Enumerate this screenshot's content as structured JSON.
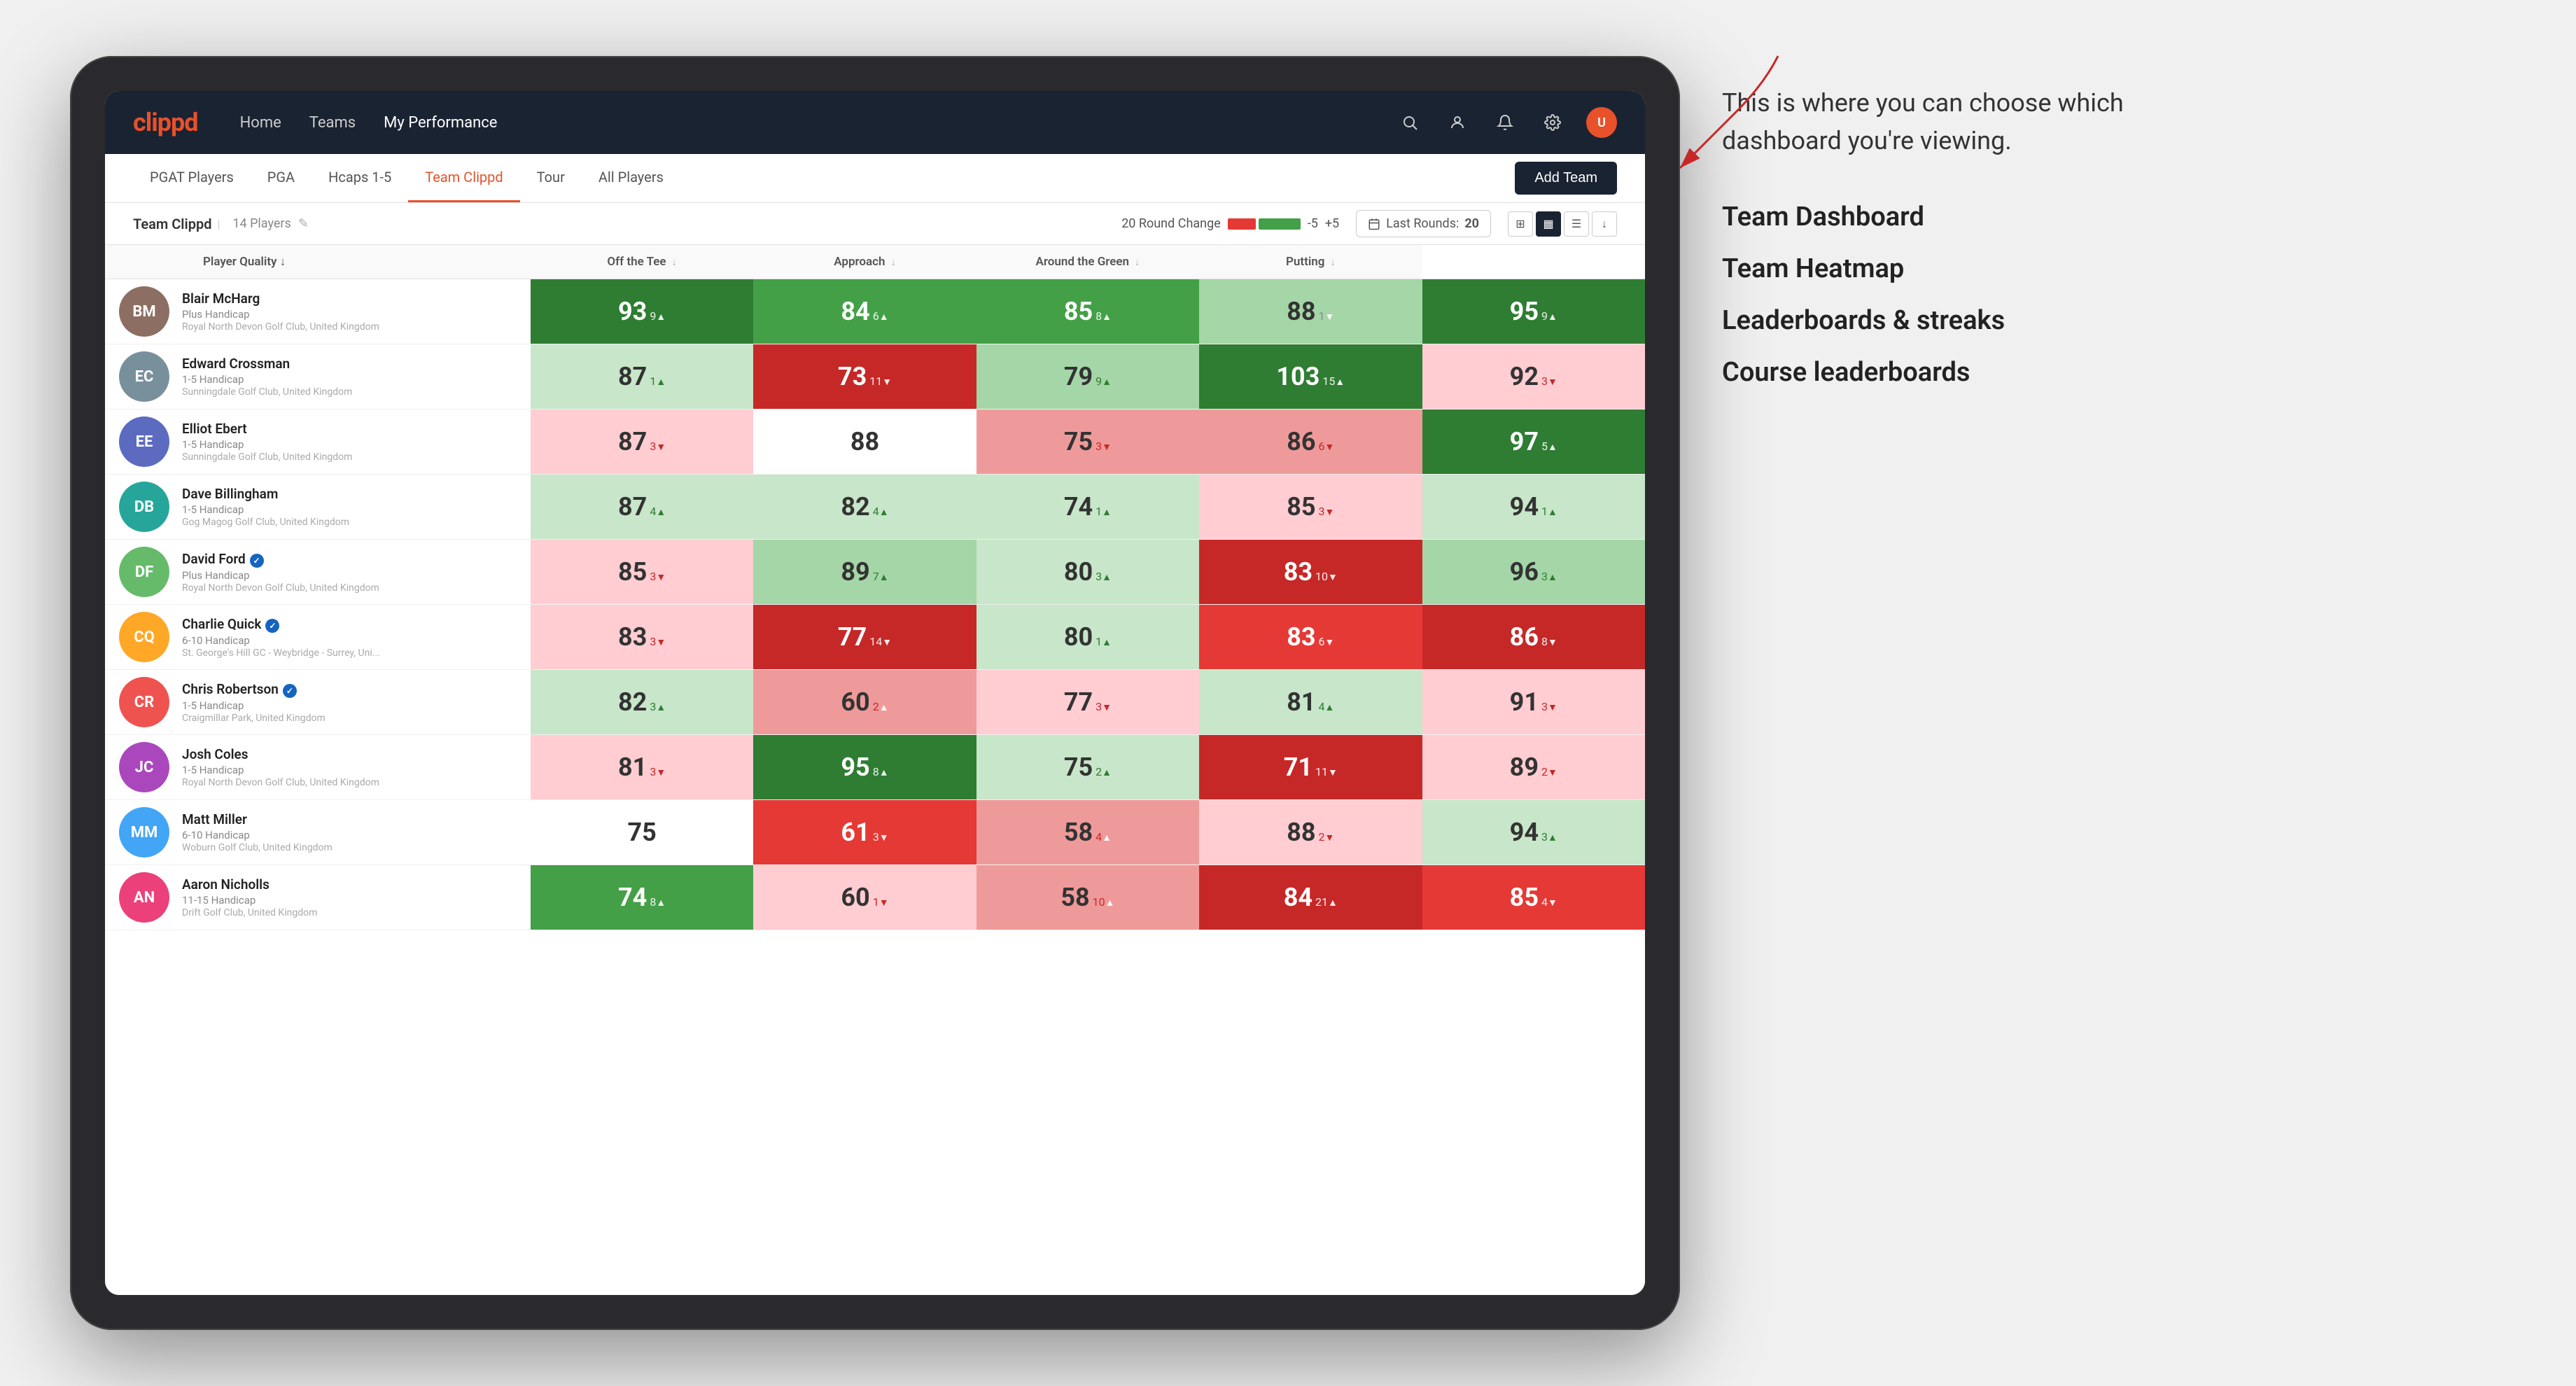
{
  "annotation": {
    "description": "This is where you can choose which dashboard you're viewing.",
    "dashboard_options": [
      "Team Dashboard",
      "Team Heatmap",
      "Leaderboards & streaks",
      "Course leaderboards"
    ]
  },
  "nav": {
    "logo": "clippd",
    "links": [
      "Home",
      "Teams",
      "My Performance"
    ],
    "active_link": "My Performance"
  },
  "sub_nav": {
    "links": [
      "PGAT Players",
      "PGA",
      "Hcaps 1-5",
      "Team Clippd",
      "Tour",
      "All Players"
    ],
    "active": "Team Clippd",
    "add_team_label": "Add Team"
  },
  "team_header": {
    "name": "Team Clippd",
    "separator": "|",
    "count": "14 Players",
    "round_change_label": "20 Round Change",
    "change_min": "-5",
    "change_max": "+5",
    "last_rounds_label": "Last Rounds:",
    "last_rounds_value": "20"
  },
  "table": {
    "columns": [
      {
        "label": "Player Quality",
        "arrow": "↓"
      },
      {
        "label": "Off the Tee",
        "arrow": "↓"
      },
      {
        "label": "Approach",
        "arrow": "↓"
      },
      {
        "label": "Around the Green",
        "arrow": "↓"
      },
      {
        "label": "Putting",
        "arrow": "↓"
      }
    ],
    "rows": [
      {
        "name": "Blair McHarg",
        "handicap": "Plus Handicap",
        "club": "Royal North Devon Golf Club, United Kingdom",
        "verified": false,
        "stats": [
          {
            "value": "93",
            "change": "9",
            "dir": "up",
            "bg": "green-dark"
          },
          {
            "value": "84",
            "change": "6",
            "dir": "up",
            "bg": "green-med"
          },
          {
            "value": "85",
            "change": "8",
            "dir": "up",
            "bg": "green-med"
          },
          {
            "value": "88",
            "change": "1",
            "dir": "down",
            "bg": "green-light"
          },
          {
            "value": "95",
            "change": "9",
            "dir": "up",
            "bg": "green-dark"
          }
        ]
      },
      {
        "name": "Edward Crossman",
        "handicap": "1-5 Handicap",
        "club": "Sunningdale Golf Club, United Kingdom",
        "verified": false,
        "stats": [
          {
            "value": "87",
            "change": "1",
            "dir": "up",
            "bg": "green-pale"
          },
          {
            "value": "73",
            "change": "11",
            "dir": "down",
            "bg": "red-dark"
          },
          {
            "value": "79",
            "change": "9",
            "dir": "up",
            "bg": "green-light"
          },
          {
            "value": "103",
            "change": "15",
            "dir": "up",
            "bg": "green-dark"
          },
          {
            "value": "92",
            "change": "3",
            "dir": "down",
            "bg": "red-pale"
          }
        ]
      },
      {
        "name": "Elliot Ebert",
        "handicap": "1-5 Handicap",
        "club": "Sunningdale Golf Club, United Kingdom",
        "verified": false,
        "stats": [
          {
            "value": "87",
            "change": "3",
            "dir": "down",
            "bg": "red-pale"
          },
          {
            "value": "88",
            "change": "",
            "dir": "neutral",
            "bg": "white"
          },
          {
            "value": "75",
            "change": "3",
            "dir": "down",
            "bg": "red-light"
          },
          {
            "value": "86",
            "change": "6",
            "dir": "down",
            "bg": "red-light"
          },
          {
            "value": "97",
            "change": "5",
            "dir": "up",
            "bg": "green-dark"
          }
        ]
      },
      {
        "name": "Dave Billingham",
        "handicap": "1-5 Handicap",
        "club": "Gog Magog Golf Club, United Kingdom",
        "verified": false,
        "stats": [
          {
            "value": "87",
            "change": "4",
            "dir": "up",
            "bg": "green-pale"
          },
          {
            "value": "82",
            "change": "4",
            "dir": "up",
            "bg": "green-pale"
          },
          {
            "value": "74",
            "change": "1",
            "dir": "up",
            "bg": "green-pale"
          },
          {
            "value": "85",
            "change": "3",
            "dir": "down",
            "bg": "red-pale"
          },
          {
            "value": "94",
            "change": "1",
            "dir": "up",
            "bg": "green-pale"
          }
        ]
      },
      {
        "name": "David Ford",
        "handicap": "Plus Handicap",
        "club": "Royal North Devon Golf Club, United Kingdom",
        "verified": true,
        "stats": [
          {
            "value": "85",
            "change": "3",
            "dir": "down",
            "bg": "red-pale"
          },
          {
            "value": "89",
            "change": "7",
            "dir": "up",
            "bg": "green-light"
          },
          {
            "value": "80",
            "change": "3",
            "dir": "up",
            "bg": "green-pale"
          },
          {
            "value": "83",
            "change": "10",
            "dir": "down",
            "bg": "red-dark"
          },
          {
            "value": "96",
            "change": "3",
            "dir": "up",
            "bg": "green-light"
          }
        ]
      },
      {
        "name": "Charlie Quick",
        "handicap": "6-10 Handicap",
        "club": "St. George's Hill GC - Weybridge - Surrey, Uni...",
        "verified": true,
        "stats": [
          {
            "value": "83",
            "change": "3",
            "dir": "down",
            "bg": "red-pale"
          },
          {
            "value": "77",
            "change": "14",
            "dir": "down",
            "bg": "red-dark"
          },
          {
            "value": "80",
            "change": "1",
            "dir": "up",
            "bg": "green-pale"
          },
          {
            "value": "83",
            "change": "6",
            "dir": "down",
            "bg": "red-med"
          },
          {
            "value": "86",
            "change": "8",
            "dir": "down",
            "bg": "red-dark"
          }
        ]
      },
      {
        "name": "Chris Robertson",
        "handicap": "1-5 Handicap",
        "club": "Craigmillar Park, United Kingdom",
        "verified": true,
        "stats": [
          {
            "value": "82",
            "change": "3",
            "dir": "up",
            "bg": "green-pale"
          },
          {
            "value": "60",
            "change": "2",
            "dir": "up",
            "bg": "red-light"
          },
          {
            "value": "77",
            "change": "3",
            "dir": "down",
            "bg": "red-pale"
          },
          {
            "value": "81",
            "change": "4",
            "dir": "up",
            "bg": "green-pale"
          },
          {
            "value": "91",
            "change": "3",
            "dir": "down",
            "bg": "red-pale"
          }
        ]
      },
      {
        "name": "Josh Coles",
        "handicap": "1-5 Handicap",
        "club": "Royal North Devon Golf Club, United Kingdom",
        "verified": false,
        "stats": [
          {
            "value": "81",
            "change": "3",
            "dir": "down",
            "bg": "red-pale"
          },
          {
            "value": "95",
            "change": "8",
            "dir": "up",
            "bg": "green-dark"
          },
          {
            "value": "75",
            "change": "2",
            "dir": "up",
            "bg": "green-pale"
          },
          {
            "value": "71",
            "change": "11",
            "dir": "down",
            "bg": "red-dark"
          },
          {
            "value": "89",
            "change": "2",
            "dir": "down",
            "bg": "red-pale"
          }
        ]
      },
      {
        "name": "Matt Miller",
        "handicap": "6-10 Handicap",
        "club": "Woburn Golf Club, United Kingdom",
        "verified": false,
        "stats": [
          {
            "value": "75",
            "change": "",
            "dir": "neutral",
            "bg": "white"
          },
          {
            "value": "61",
            "change": "3",
            "dir": "down",
            "bg": "red-med"
          },
          {
            "value": "58",
            "change": "4",
            "dir": "up",
            "bg": "red-light"
          },
          {
            "value": "88",
            "change": "2",
            "dir": "down",
            "bg": "red-pale"
          },
          {
            "value": "94",
            "change": "3",
            "dir": "up",
            "bg": "green-pale"
          }
        ]
      },
      {
        "name": "Aaron Nicholls",
        "handicap": "11-15 Handicap",
        "club": "Drift Golf Club, United Kingdom",
        "verified": false,
        "stats": [
          {
            "value": "74",
            "change": "8",
            "dir": "up",
            "bg": "green-med"
          },
          {
            "value": "60",
            "change": "1",
            "dir": "down",
            "bg": "red-pale"
          },
          {
            "value": "58",
            "change": "10",
            "dir": "up",
            "bg": "red-light"
          },
          {
            "value": "84",
            "change": "21",
            "dir": "up",
            "bg": "red-dark"
          },
          {
            "value": "85",
            "change": "4",
            "dir": "down",
            "bg": "red-med"
          }
        ]
      }
    ]
  }
}
